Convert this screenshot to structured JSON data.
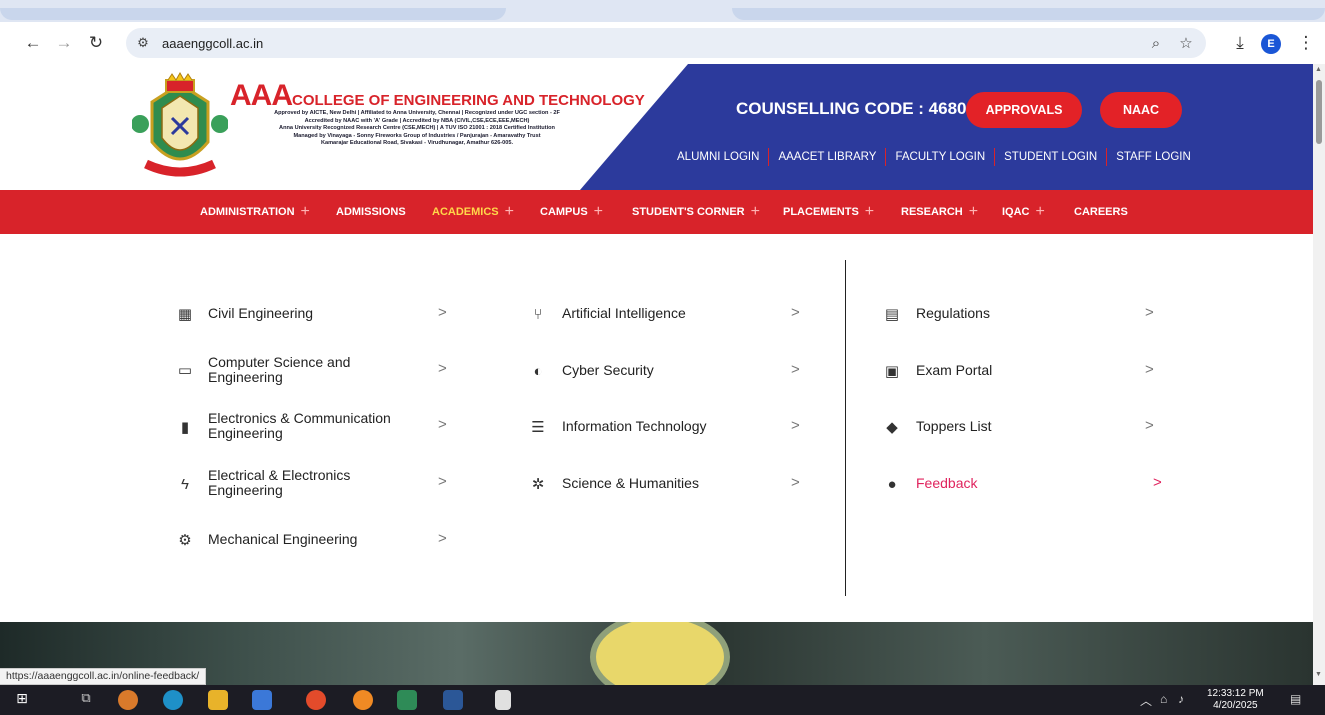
{
  "browser": {
    "url": "aaaenggcoll.ac.in",
    "profile_initial": "E",
    "status_url": "https://aaaenggcoll.ac.in/online-feedback/"
  },
  "header": {
    "college_name_big": "AAA",
    "college_name_rest": "COLLEGE OF ENGINEERING AND TECHNOLOGY",
    "sub_lines": [
      "Approved by AICTE, New Delhi | Affiliated to Anna University, Chennai | Recognized under UGC section - 2F",
      "Accredited by NAAC with 'A' Grade | Accredited by NBA (CIVIL,CSE,ECE,EEE,MECH)",
      "Anna University Recognized Research Centre (CSE,MECH) | A TUV ISO 21001 : 2018 Certified Institution",
      "Managed by Vinayaga - Sonny Fireworks Group of Industries / Panjurajan - Amaravathy Trust",
      "Kamarajar Educational Road, Sivakasi - Virudhunagar, Amathur 626-005."
    ],
    "counselling": "COUNSELLING CODE : 4680",
    "approvals_label": "APPROVALS",
    "naac_label": "NAAC",
    "login_links": [
      "ALUMNI LOGIN",
      "AAACET LIBRARY",
      "FACULTY LOGIN",
      "STUDENT LOGIN",
      "STAFF LOGIN"
    ]
  },
  "nav": {
    "items": [
      {
        "label": "ADMINISTRATION",
        "plus": "+"
      },
      {
        "label": "ADMISSIONS",
        "plus": ""
      },
      {
        "label": "ACADEMICS",
        "plus": "+",
        "active": true
      },
      {
        "label": "CAMPUS",
        "plus": "+"
      },
      {
        "label": "STUDENT'S CORNER",
        "plus": "+"
      },
      {
        "label": "PLACEMENTS",
        "plus": "+"
      },
      {
        "label": "RESEARCH",
        "plus": "+"
      },
      {
        "label": "IQAC",
        "plus": "+"
      },
      {
        "label": "CAREERS",
        "plus": ""
      }
    ]
  },
  "mega_menu": {
    "arrow": ">",
    "col1": [
      {
        "icon": "building-icon",
        "label": "Civil Engineering"
      },
      {
        "icon": "monitor-icon",
        "label": "Computer Science and Engineering"
      },
      {
        "icon": "chip-icon",
        "label": "Electronics & Communication Engineering"
      },
      {
        "icon": "bolt-icon",
        "label": "Electrical & Electronics Engineering"
      },
      {
        "icon": "gears-icon",
        "label": "Mechanical Engineering"
      }
    ],
    "col2": [
      {
        "icon": "branch-icon",
        "label": "Artificial Intelligence"
      },
      {
        "icon": "shield-icon",
        "label": "Cyber Security"
      },
      {
        "icon": "database-icon",
        "label": "Information Technology"
      },
      {
        "icon": "cog-icon",
        "label": "Science & Humanities"
      }
    ],
    "col3": [
      {
        "icon": "clipboard-list-icon",
        "label": "Regulations"
      },
      {
        "icon": "clipboard-check-icon",
        "label": "Exam Portal"
      },
      {
        "icon": "graduation-cap-icon",
        "label": "Toppers List"
      },
      {
        "icon": "comment-icon",
        "label": "Feedback",
        "highlight": true
      }
    ]
  },
  "taskbar": {
    "time": "12:33:12 PM",
    "date": "4/20/2025"
  }
}
